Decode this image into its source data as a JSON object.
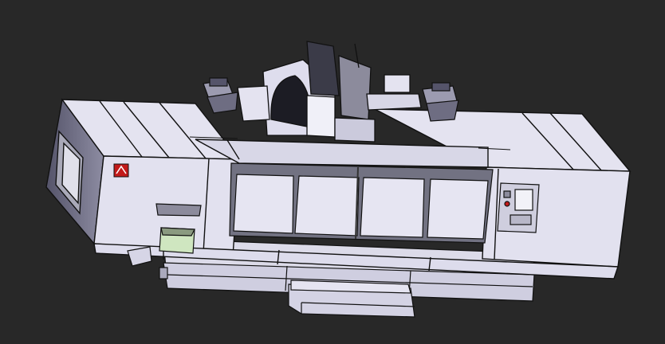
{
  "scene": {
    "subject": "cnc-machining-center-3d-model",
    "background_color": "#282828",
    "body_color": "#e2e1ef",
    "panel_color": "#d6d5e6",
    "edge_color": "#111111",
    "window_color": "#9a9ca8",
    "logo_color": "#c21a1a",
    "tray_color": "#cfe6c0"
  },
  "parts": {
    "enclosure": "main-enclosure",
    "spindle_head": "spindle-head",
    "doors": [
      "door-1",
      "door-2",
      "door-3",
      "door-4"
    ],
    "control_panel": "control-panel",
    "left_motor": "left-axis-motor",
    "right_motor": "right-axis-motor",
    "steps": "access-steps",
    "logo": "brand-logo-icon"
  }
}
